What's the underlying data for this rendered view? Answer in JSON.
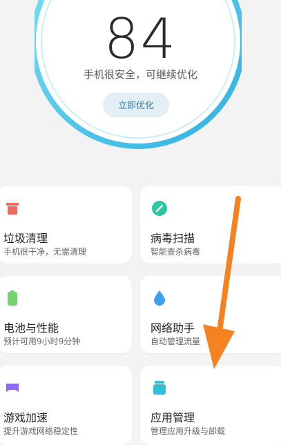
{
  "score": {
    "value": "84",
    "status": "手机很安全，可继续优化",
    "button_label": "立即优化",
    "ring_color": "#4cc3e8"
  },
  "cards": [
    {
      "title": "垃圾清理",
      "subtitle": "手机很干净，无需清理",
      "icon": "trash-icon",
      "color": "#f06a5f"
    },
    {
      "title": "病毒扫描",
      "subtitle": "智能查杀病毒",
      "icon": "virus-scan-icon",
      "color": "#2fc7a2"
    },
    {
      "title": "电池与性能",
      "subtitle": "预计可用9小时9分钟",
      "icon": "battery-icon",
      "color": "#74d36d"
    },
    {
      "title": "网络助手",
      "subtitle": "自动管理流量",
      "icon": "water-drop-icon",
      "color": "#3aa1ea"
    },
    {
      "title": "游戏加速",
      "subtitle": "提升游戏网络稳定性",
      "icon": "gamepad-icon",
      "color": "#8b6cf0"
    },
    {
      "title": "应用管理",
      "subtitle": "管理应用升级与卸载",
      "icon": "app-box-icon",
      "color": "#2fc0d8"
    }
  ],
  "annotation": {
    "arrow_color": "#f58220"
  }
}
